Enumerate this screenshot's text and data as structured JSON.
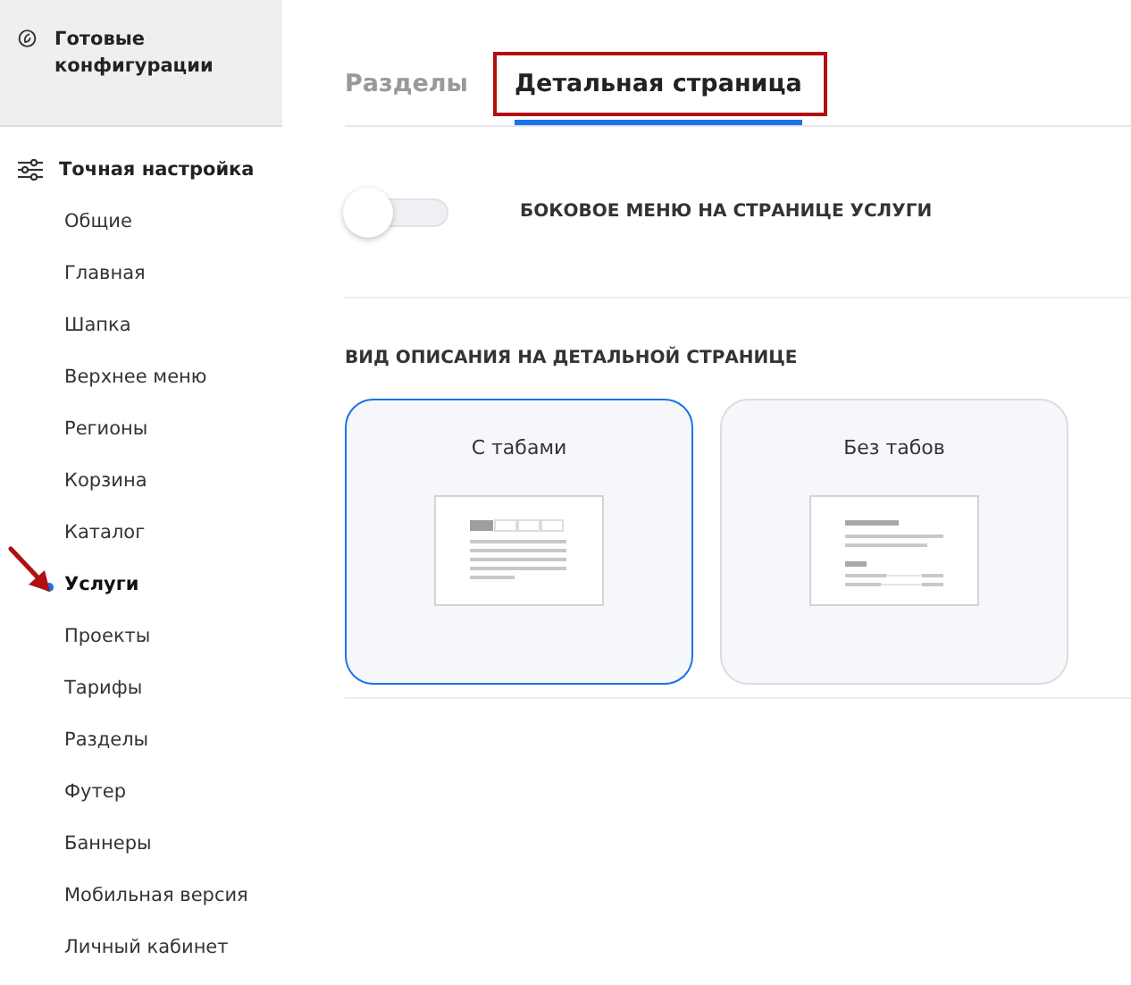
{
  "sidebar": {
    "presets": {
      "label": "Готовые конфигурации",
      "selected": false
    },
    "fine_tuning": {
      "label": "Точная настройка"
    },
    "items": [
      {
        "label": "Общие",
        "selected": false,
        "pointed": false
      },
      {
        "label": "Главная",
        "selected": false,
        "pointed": false
      },
      {
        "label": "Шапка",
        "selected": false,
        "pointed": false
      },
      {
        "label": "Верхнее меню",
        "selected": false,
        "pointed": false
      },
      {
        "label": "Регионы",
        "selected": false,
        "pointed": false
      },
      {
        "label": "Корзина",
        "selected": false,
        "pointed": false
      },
      {
        "label": "Каталог",
        "selected": false,
        "pointed": false
      },
      {
        "label": "Услуги",
        "selected": true,
        "pointed": true
      },
      {
        "label": "Проекты",
        "selected": false,
        "pointed": false
      },
      {
        "label": "Тарифы",
        "selected": false,
        "pointed": false
      },
      {
        "label": "Разделы",
        "selected": false,
        "pointed": false
      },
      {
        "label": "Футер",
        "selected": false,
        "pointed": false
      },
      {
        "label": "Баннеры",
        "selected": false,
        "pointed": false
      },
      {
        "label": "Мобильная версия",
        "selected": false,
        "pointed": false
      },
      {
        "label": "Личный кабинет",
        "selected": false,
        "pointed": false
      }
    ]
  },
  "tabs": [
    {
      "label": "Разделы",
      "selected": false,
      "highlighted": false
    },
    {
      "label": "Детальная страница",
      "selected": true,
      "highlighted": true
    }
  ],
  "toggle": {
    "label": "БОКОВОЕ МЕНЮ НА СТРАНИЦЕ УСЛУГИ",
    "on": false
  },
  "description_view": {
    "title": "ВИД ОПИСАНИЯ НА ДЕТАЛЬНОЙ СТРАНИЦЕ",
    "options": [
      {
        "label": "С табами",
        "kind": "tabs",
        "selected": true
      },
      {
        "label": "Без табов",
        "kind": "plain",
        "selected": false
      }
    ]
  }
}
